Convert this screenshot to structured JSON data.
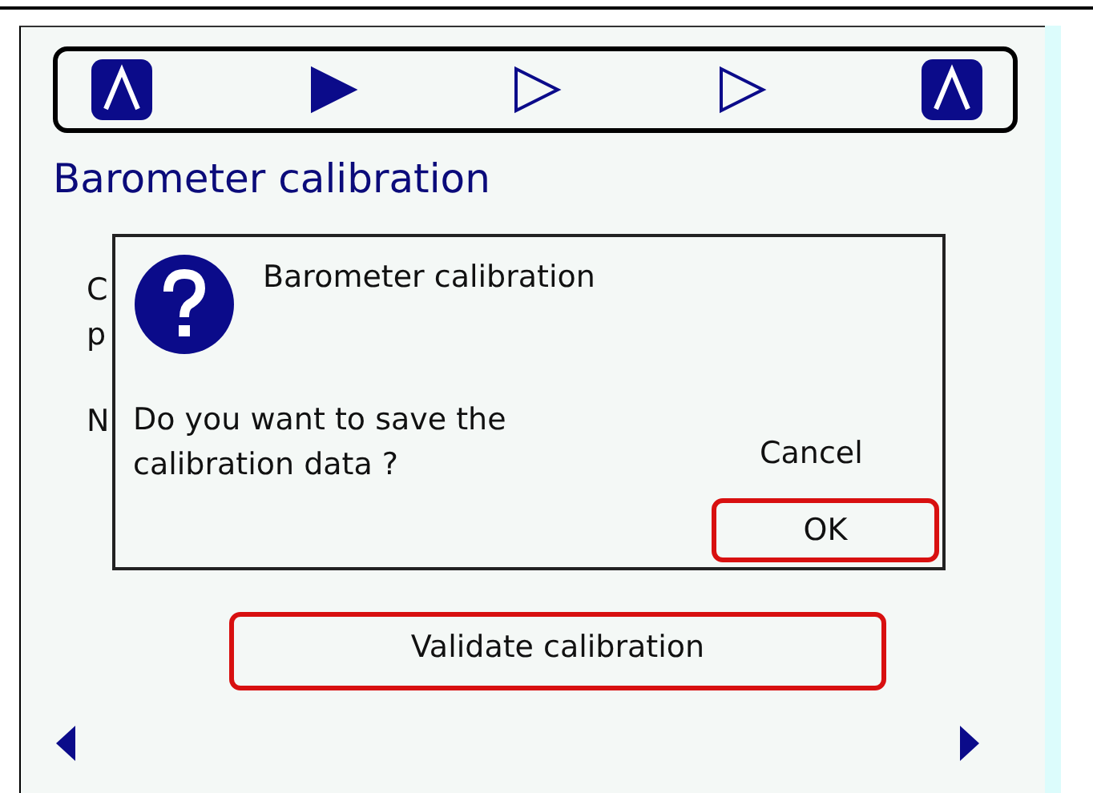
{
  "title": "Barometer calibration",
  "steps": [
    {
      "kind": "logo"
    },
    {
      "kind": "step",
      "selected": true
    },
    {
      "kind": "step",
      "selected": false
    },
    {
      "kind": "step",
      "selected": false
    },
    {
      "kind": "logo"
    }
  ],
  "hidden_text": [
    "C",
    "p",
    "N"
  ],
  "dialog": {
    "title": "Barometer calibration",
    "message": "Do you want to save the calibration data ?",
    "cancel": "Cancel",
    "ok": "OK"
  },
  "validate_button": "Validate calibration"
}
